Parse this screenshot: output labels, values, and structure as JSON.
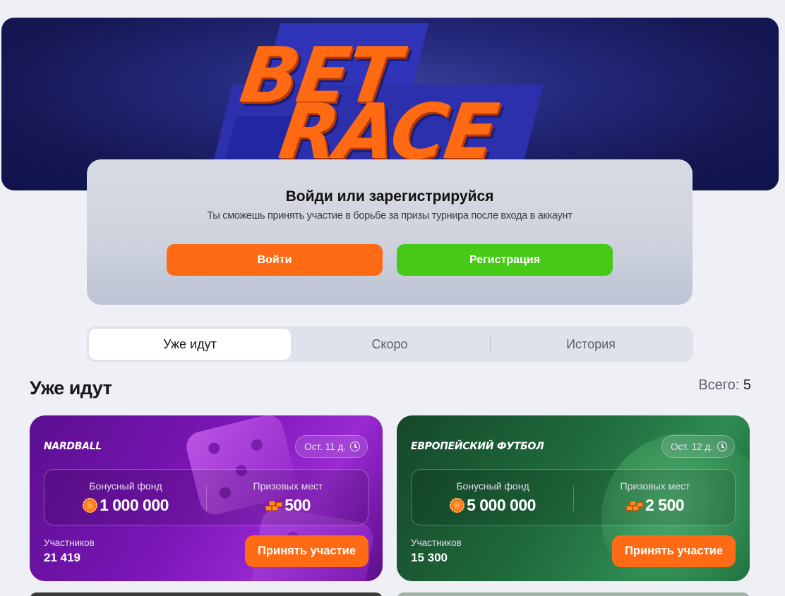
{
  "hero": {
    "logo_line1": "BET",
    "logo_line2": "RACE"
  },
  "auth": {
    "title": "Войди или зарегистрируйся",
    "subtitle": "Ты сможешь принять участие в борьбе за призы турнира после входа в аккаунт",
    "login_label": "Войти",
    "register_label": "Регистрация"
  },
  "tabs": [
    {
      "label": "Уже идут",
      "active": true
    },
    {
      "label": "Скоро",
      "active": false
    },
    {
      "label": "История",
      "active": false
    }
  ],
  "section": {
    "title": "Уже идут",
    "total_label": "Всего:",
    "total_count": "5"
  },
  "tournaments": [
    {
      "name": "NARDBALL",
      "time_left": "Ост. 11 д.",
      "bonus_label": "Бонусный фонд",
      "bonus_value": "1 000 000",
      "places_label": "Призовых мест",
      "places_value": "500",
      "participants_label": "Участников",
      "participants_value": "21 419",
      "join_label": "Принять участие"
    },
    {
      "name": "Европейский футбол",
      "time_left": "Ост. 12 д.",
      "bonus_label": "Бонусный фонд",
      "bonus_value": "5 000 000",
      "places_label": "Призовых мест",
      "places_value": "2 500",
      "participants_label": "Участников",
      "participants_value": "15 300",
      "join_label": "Принять участие"
    }
  ],
  "colors": {
    "accent_orange": "#ff6a14",
    "accent_green": "#47c918",
    "hero_bg": "#1c1f66"
  },
  "icons": [
    "clock-icon",
    "coin-icon",
    "blocks-icon"
  ]
}
